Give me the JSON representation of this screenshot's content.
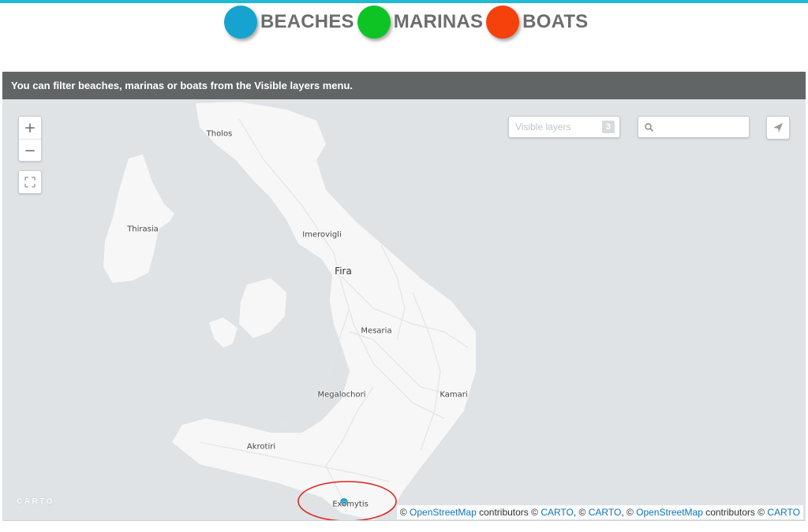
{
  "legend": {
    "items": [
      {
        "label": "BEACHES",
        "color": "#16a3cf"
      },
      {
        "label": "MARINAS",
        "color": "#0ec425"
      },
      {
        "label": "BOATS",
        "color": "#f5410b"
      }
    ]
  },
  "map": {
    "info_text": "You can filter beaches, marinas or boats from the Visible layers menu.",
    "zoom_in_label": "+",
    "zoom_out_label": "−",
    "visible_layers": {
      "label": "Visible layers",
      "count": "3"
    },
    "search": {
      "placeholder": "",
      "value": ""
    },
    "logo_text": "CARTO",
    "places": [
      {
        "name": "Tholos"
      },
      {
        "name": "Thirasia"
      },
      {
        "name": "Imerovigli"
      },
      {
        "name": "Fira"
      },
      {
        "name": "Mesaria"
      },
      {
        "name": "Megalochori"
      },
      {
        "name": "Kamari"
      },
      {
        "name": "Akrotiri"
      },
      {
        "name": "Exomytis"
      }
    ],
    "marker": {
      "layer": "BEACHES",
      "color": "#1ea3cc"
    },
    "highlight_color": "#e02020",
    "attribution": {
      "sep_open": "© ",
      "osm1": "OpenStreetMap",
      "text1": " contributors © ",
      "carto1": "CARTO",
      "sep2": ", © ",
      "carto2": "CARTO",
      "sep3": ", © ",
      "osm2": "OpenStreetMap",
      "text2": " contributors © ",
      "carto3": "CARTO"
    },
    "colors": {
      "sea": "#dfe3e6",
      "land": "#f7f7f7",
      "roads": "#e4e4e4",
      "info_bar": "#616565"
    }
  }
}
